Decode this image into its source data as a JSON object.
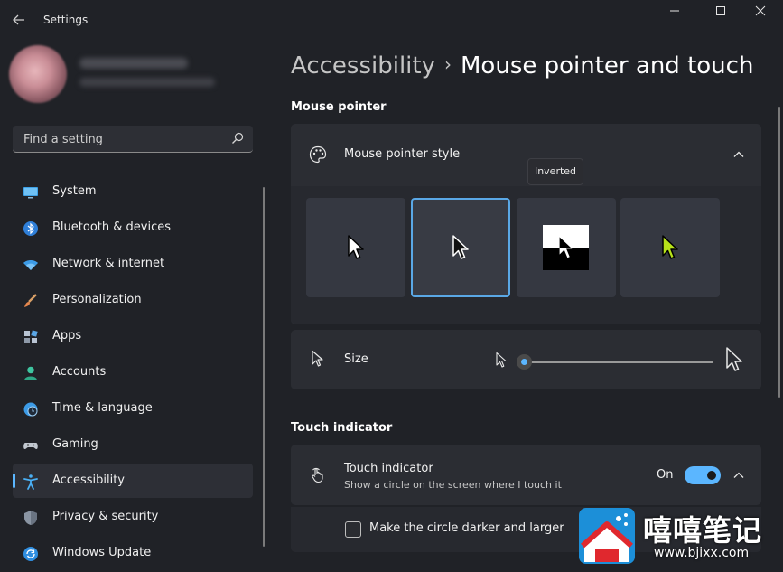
{
  "window": {
    "title": "Settings"
  },
  "search": {
    "placeholder": "Find a setting"
  },
  "sidebar": {
    "items": [
      {
        "label": "System"
      },
      {
        "label": "Bluetooth & devices"
      },
      {
        "label": "Network & internet"
      },
      {
        "label": "Personalization"
      },
      {
        "label": "Apps"
      },
      {
        "label": "Accounts"
      },
      {
        "label": "Time & language"
      },
      {
        "label": "Gaming"
      },
      {
        "label": "Accessibility",
        "active": true
      },
      {
        "label": "Privacy & security"
      },
      {
        "label": "Windows Update"
      }
    ]
  },
  "breadcrumb": {
    "parent": "Accessibility",
    "separator": "›",
    "current": "Mouse pointer and touch"
  },
  "mouse_pointer": {
    "section_title": "Mouse pointer",
    "style_label": "Mouse pointer style",
    "tooltip": "Inverted",
    "styles": [
      "white",
      "black",
      "inverted",
      "custom"
    ],
    "selected_style": "black",
    "size_label": "Size",
    "size_value": 0
  },
  "touch": {
    "section_title": "Touch indicator",
    "label": "Touch indicator",
    "description": "Show a circle on the screen where I touch it",
    "toggle_state": "On",
    "option_label": "Make the circle darker and larger",
    "option_checked": false
  },
  "watermark": {
    "title": "嘻嘻笔记",
    "url": "www.bjixx.com"
  },
  "colors": {
    "accent": "#5bb6ff",
    "background": "#202227",
    "card": "#2b2d33"
  }
}
